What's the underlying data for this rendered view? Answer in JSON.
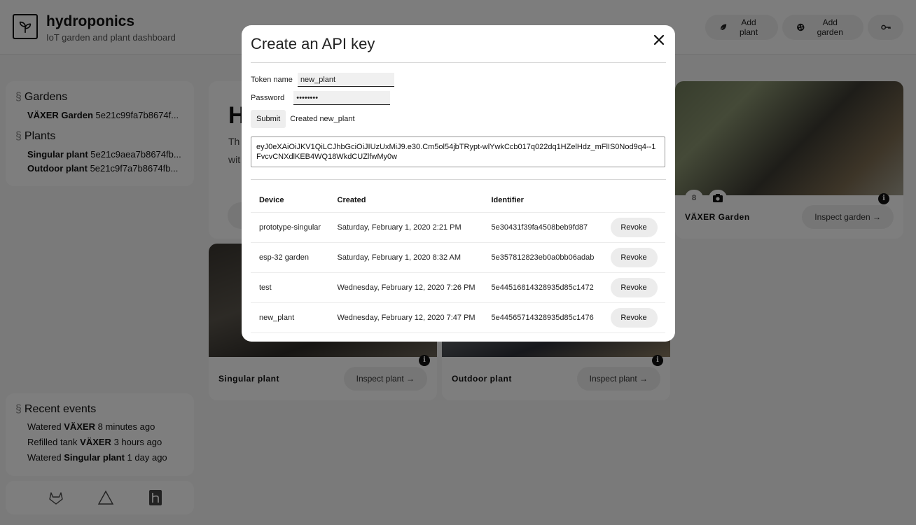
{
  "app": {
    "title": "hydroponics",
    "subtitle": "IoT garden and plant dashboard"
  },
  "header": {
    "add_plant": "Add plant",
    "add_garden": "Add garden"
  },
  "sidebar": {
    "gardens_title": "Gardens",
    "section_mark": "§",
    "gardens": [
      {
        "name": "VÄXER Garden",
        "id": "5e21c99fa7b8674f..."
      }
    ],
    "plants_title": "Plants",
    "plants": [
      {
        "name": "Singular plant",
        "id": "5e21c9aea7b8674fb..."
      },
      {
        "name": "Outdoor plant",
        "id": "5e21c9f7a7b8674fb..."
      }
    ],
    "events_title": "Recent events",
    "events": [
      {
        "pre": "Watered ",
        "target": "VÄXER",
        "post": " 8 minutes ago"
      },
      {
        "pre": "Refilled tank ",
        "target": "VÄXER",
        "post": " 3 hours ago"
      },
      {
        "pre": "Watered ",
        "target": "Singular plant",
        "post": " 1 day ago"
      }
    ]
  },
  "main": {
    "hero_letter": "H",
    "hero_line1": "Th",
    "hero_line2": "wit",
    "garden_card": {
      "name": "VÄXER Garden",
      "button": "Inspect garden →",
      "count": "8"
    },
    "plant_cards": [
      {
        "name": "Singular plant",
        "button": "Inspect plant →"
      },
      {
        "name": "Outdoor plant",
        "button": "Inspect plant →"
      }
    ]
  },
  "modal": {
    "title": "Create an API key",
    "token_label": "Token name",
    "token_value": "new_plant",
    "password_label": "Password",
    "password_value": "••••••••",
    "submit": "Submit",
    "status": "Created new_plant",
    "token": "eyJ0eXAiOiJKV1QiLCJhbGciOiJIUzUxMiJ9.e30.Cm5ol54jbTRypt-wlYwkCcb017q022dq1HZelHdz_mFlIS0Nod9q4--1FvcvCNXdlKEB4WQ18WkdCUZlfwMy0w",
    "columns": {
      "device": "Device",
      "created": "Created",
      "identifier": "Identifier"
    },
    "revoke": "Revoke",
    "keys": [
      {
        "device": "prototype-singular",
        "created": "Saturday, February 1, 2020 2:21 PM",
        "identifier": "5e30431f39fa4508beb9fd87"
      },
      {
        "device": "esp-32 garden",
        "created": "Saturday, February 1, 2020 8:32 AM",
        "identifier": "5e357812823eb0a0bb06adab"
      },
      {
        "device": "test",
        "created": "Wednesday, February 12, 2020 7:26 PM",
        "identifier": "5e44516814328935d85c1472"
      },
      {
        "device": "new_plant",
        "created": "Wednesday, February 12, 2020 7:47 PM",
        "identifier": "5e44565714328935d85c1476"
      }
    ]
  }
}
